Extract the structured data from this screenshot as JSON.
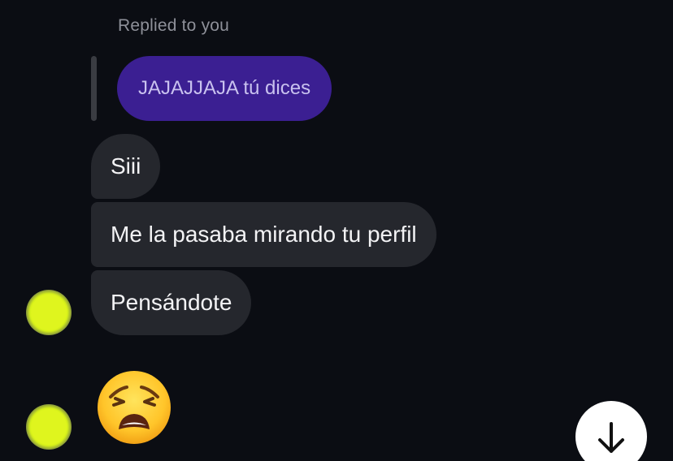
{
  "reply_header": {
    "label": "Replied to you"
  },
  "quoted_message": {
    "text": "JAJAJJAJA tú dices",
    "color": "#3b1f92"
  },
  "messages": [
    {
      "text": "Siii"
    },
    {
      "text": "Me la pasaba mirando tu perfil"
    },
    {
      "text": "Pensándote"
    }
  ],
  "emoji_message": {
    "icon": "weary-face-icon"
  },
  "avatar": {
    "icon": "avatar-icon",
    "color": "#dff51e"
  },
  "scroll_button": {
    "icon": "arrow-down-icon"
  },
  "colors": {
    "background": "#0b0d13",
    "incoming_bubble": "#25272d",
    "outgoing_bubble": "#3b1f92"
  }
}
